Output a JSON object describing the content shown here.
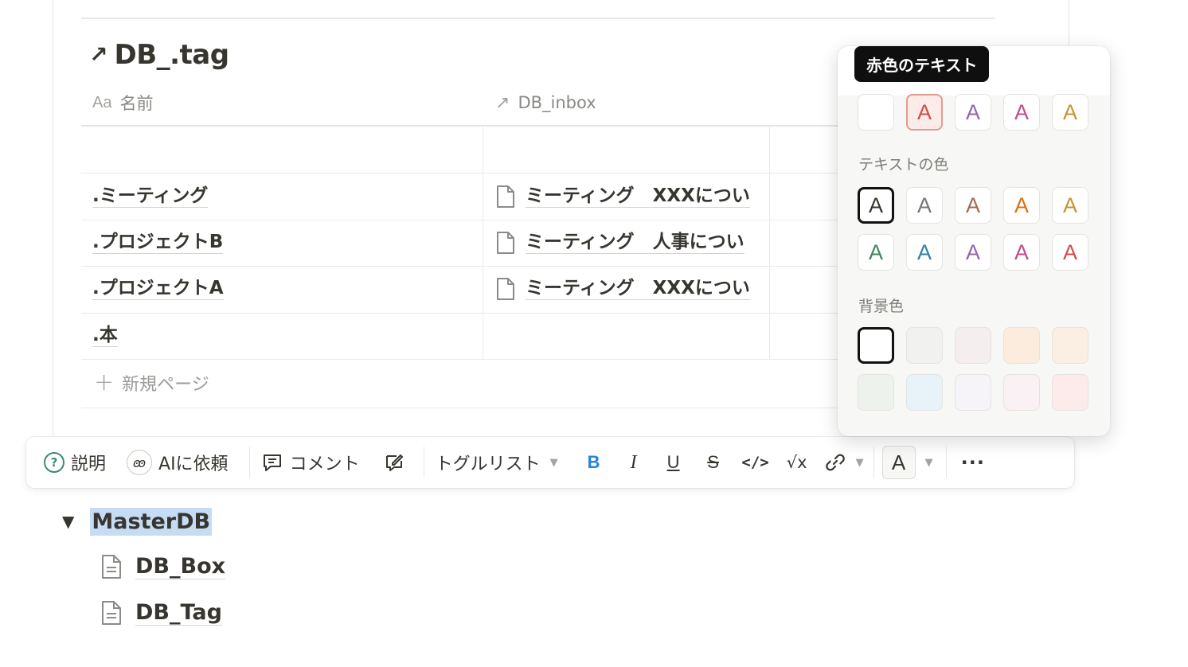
{
  "database": {
    "title": "DB_.tag",
    "title_icon": "arrow-up-right-icon",
    "columns": [
      {
        "label": "名前",
        "icon": "Aa"
      },
      {
        "label": "DB_inbox",
        "icon": "↗"
      }
    ],
    "rows": [
      {
        "name": "",
        "relation": ""
      },
      {
        "name": ".ミーティング",
        "relation": "ミーティング　XXXについ"
      },
      {
        "name": ".プロジェクトB",
        "relation": "ミーティング　人事につい"
      },
      {
        "name": ".プロジェクトA",
        "relation": "ミーティング　XXXについ"
      },
      {
        "name": ".本",
        "relation": ""
      }
    ],
    "new_page_label": "新規ページ"
  },
  "toolbar": {
    "explain": "説明",
    "ask_ai": "AIに依頼",
    "comment": "コメント",
    "block_type": "トグルリスト",
    "bold": "B",
    "italic": "I",
    "underline": "U",
    "strike": "S",
    "code": "</>",
    "math": "√x",
    "color": "A",
    "more": "···"
  },
  "tree": {
    "toggle_label": "MasterDB",
    "children": [
      "DB_Box",
      "DB_Tag"
    ]
  },
  "color_menu": {
    "tooltip": "赤色のテキスト",
    "text_color_label": "テキストの色",
    "background_label": "背景色",
    "glyph": "A",
    "recent": [
      {
        "glyph": "",
        "color": "#ffffff"
      },
      {
        "glyph": "A",
        "color": "#d44c47"
      },
      {
        "glyph": "A",
        "color": "#9065b0"
      },
      {
        "glyph": "A",
        "color": "#c14c8a"
      },
      {
        "glyph": "A",
        "color": "#cb912f"
      }
    ],
    "text_colors": [
      "#37352f",
      "#787774",
      "#9f6b53",
      "#d9730d",
      "#cb912f",
      "#448361",
      "#337ea9",
      "#9065b0",
      "#c14c8a",
      "#d44c47"
    ],
    "background_colors": [
      "#ffffff",
      "#f1f1ef",
      "#f4eeee",
      "#fbecdd",
      "#fbeee2",
      "#edf3ec",
      "#e7f3f8",
      "#f6f3f9",
      "#faf1f5",
      "#fdebec"
    ]
  }
}
